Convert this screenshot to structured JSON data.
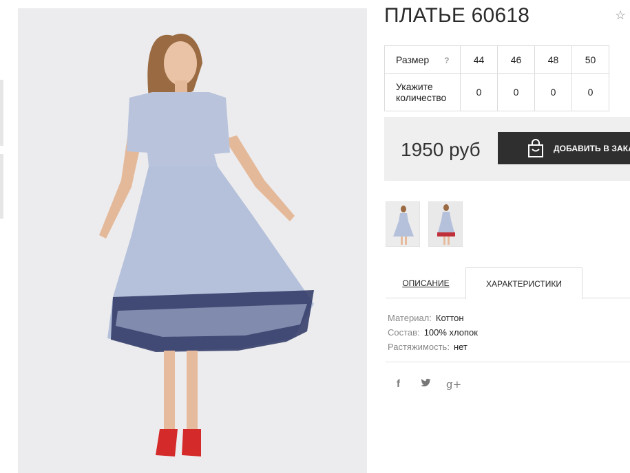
{
  "product": {
    "title": "ПЛАТЬЕ 60618",
    "favorite_icon": "☆"
  },
  "size_table": {
    "size_label": "Размер",
    "help_icon": "?",
    "sizes": [
      "44",
      "46",
      "48",
      "50"
    ],
    "qty_label_line1": "Укажите",
    "qty_label_line2": "количество",
    "quantities": [
      "0",
      "0",
      "0",
      "0"
    ]
  },
  "purchase": {
    "price": "1950 руб",
    "add_to_cart_label": "ДОБАВИТЬ В ЗАКАЗ"
  },
  "tabs": [
    {
      "label": "ОПИСАНИЕ",
      "active": false
    },
    {
      "label": "ХАРАКТЕРИСТИКИ",
      "active": true
    }
  ],
  "specs": [
    {
      "key": "Материал:",
      "value": "Коттон"
    },
    {
      "key": "Состав:",
      "value": "100% хлопок"
    },
    {
      "key": "Растяжимость:",
      "value": "нет"
    }
  ],
  "social": {
    "facebook": "f",
    "twitter": "🐦",
    "googleplus": "g+"
  },
  "colors": {
    "dress": "#b7c3dc",
    "embroidery": "#2b3563",
    "shoes": "#d42a2a",
    "button_bg": "#2f2f2f",
    "price_bar_bg": "#efefef"
  }
}
